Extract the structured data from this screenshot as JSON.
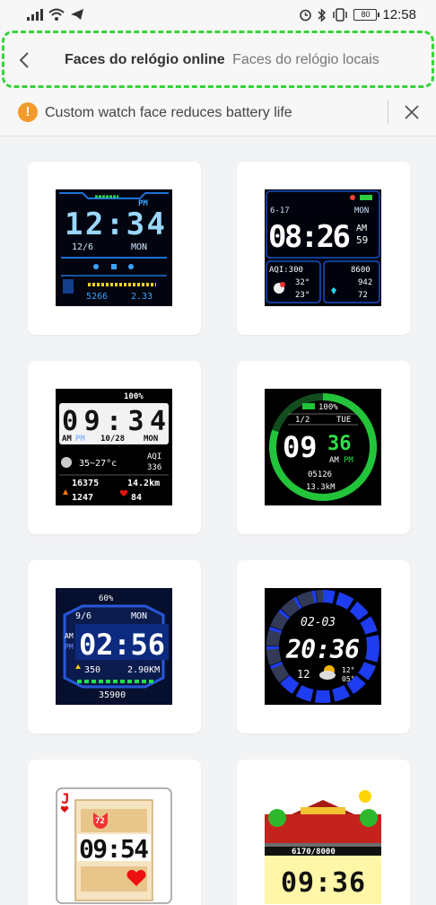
{
  "status_bar": {
    "battery": "80",
    "time": "12:58"
  },
  "header": {
    "tab_online": "Faces do relógio online",
    "tab_local": "Faces do relógio locais"
  },
  "warning": {
    "icon_glyph": "!",
    "text": "Custom watch face reduces battery life"
  },
  "faces": [
    {
      "time": "12:34",
      "ampm": "PM",
      "date": "12/6",
      "day": "MON",
      "steps": "5266",
      "distance": "2.33"
    },
    {
      "date": "6-17",
      "day": "MON",
      "time": "08:26",
      "ampm": "AM",
      "seconds": "59",
      "aqi": "AQI:300",
      "steps": "8600",
      "temp_high": "32°",
      "temp_low": "23°",
      "calories": "942",
      "heart": "72"
    },
    {
      "battery": "100%",
      "time": "09:34",
      "am": "AM",
      "pm": "PM",
      "date": "10/28",
      "day": "MON",
      "temp": "35~27°c",
      "aqi_label": "AQI",
      "aqi": "336",
      "steps": "16375",
      "distance": "14.2km",
      "calories": "1247",
      "heart": "84"
    },
    {
      "battery": "100%",
      "date": "1/2",
      "day": "TUE",
      "hour": "09",
      "minute": "36",
      "am": "AM",
      "pm": "PM",
      "steps": "05126",
      "distance": "13.3kM"
    },
    {
      "battery": "60%",
      "date": "9/6",
      "day": "MON",
      "am": "AM",
      "pm": "PM",
      "time": "02:56",
      "calories": "350",
      "distance": "2.90KM",
      "steps": "35900"
    },
    {
      "date": "02-03",
      "time": "20:36",
      "temp_high": "12°",
      "temp_low": "05°",
      "temp_main": "12"
    },
    {
      "card_rank": "J",
      "time": "09:54",
      "heart": "72"
    },
    {
      "steps": "6170/8000",
      "time": "09:36"
    }
  ]
}
